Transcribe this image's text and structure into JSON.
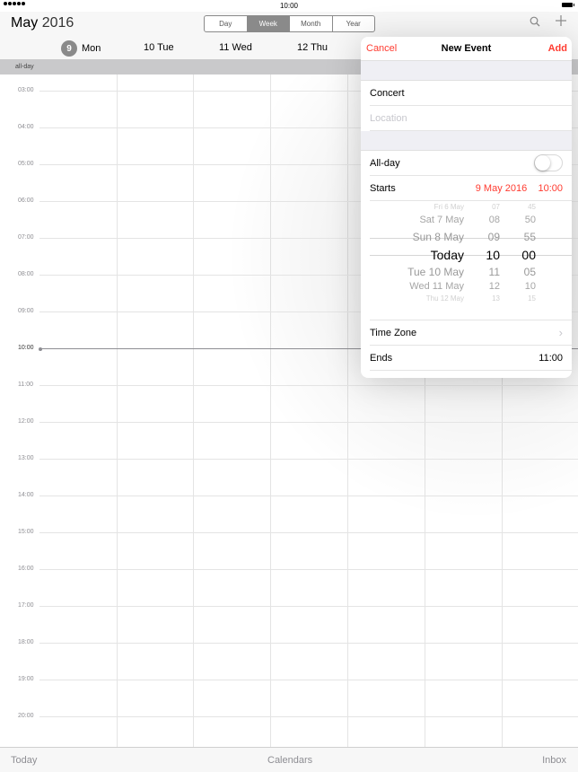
{
  "status": {
    "time": "10:00"
  },
  "header": {
    "month": "May",
    "year": "2016",
    "segments": [
      "Day",
      "Week",
      "Month",
      "Year"
    ],
    "active_segment": "Week",
    "search_icon": "search-icon",
    "add_icon": "plus-icon"
  },
  "days": [
    {
      "num": "9",
      "name": "Mon",
      "today": true
    },
    {
      "label": "10 Tue"
    },
    {
      "label": "11 Wed"
    },
    {
      "label": "12 Thu"
    }
  ],
  "allday_label": "all-day",
  "hours": [
    "03:00",
    "04:00",
    "05:00",
    "06:00",
    "07:00",
    "08:00",
    "09:00",
    "10:00",
    "11:00",
    "12:00",
    "13:00",
    "14:00",
    "15:00",
    "16:00",
    "17:00",
    "18:00",
    "19:00",
    "20:00"
  ],
  "now_label": "10:00",
  "toolbar": {
    "today": "Today",
    "calendars": "Calendars",
    "inbox": "Inbox"
  },
  "event": {
    "cancel": "Cancel",
    "title": "New Event",
    "add": "Add",
    "name_value": "Concert",
    "location_placeholder": "Location",
    "allday_label": "All-day",
    "allday_on": false,
    "starts_label": "Starts",
    "starts_date": "9 May 2016",
    "starts_time": "10:00",
    "picker": [
      {
        "day": "Fri 6 May",
        "hour": "07",
        "min": "45"
      },
      {
        "day": "Sat 7 May",
        "hour": "08",
        "min": "50"
      },
      {
        "day": "Sun 8 May",
        "hour": "09",
        "min": "55"
      },
      {
        "day": "Today",
        "hour": "10",
        "min": "00"
      },
      {
        "day": "Tue 10 May",
        "hour": "11",
        "min": "05"
      },
      {
        "day": "Wed 11 May",
        "hour": "12",
        "min": "10"
      },
      {
        "day": "Thu 12 May",
        "hour": "13",
        "min": "15"
      }
    ],
    "timezone_label": "Time Zone",
    "ends_label": "Ends",
    "ends_time": "11:00"
  },
  "colors": {
    "accent": "#ff3b30",
    "gray": "#8e8e93"
  }
}
